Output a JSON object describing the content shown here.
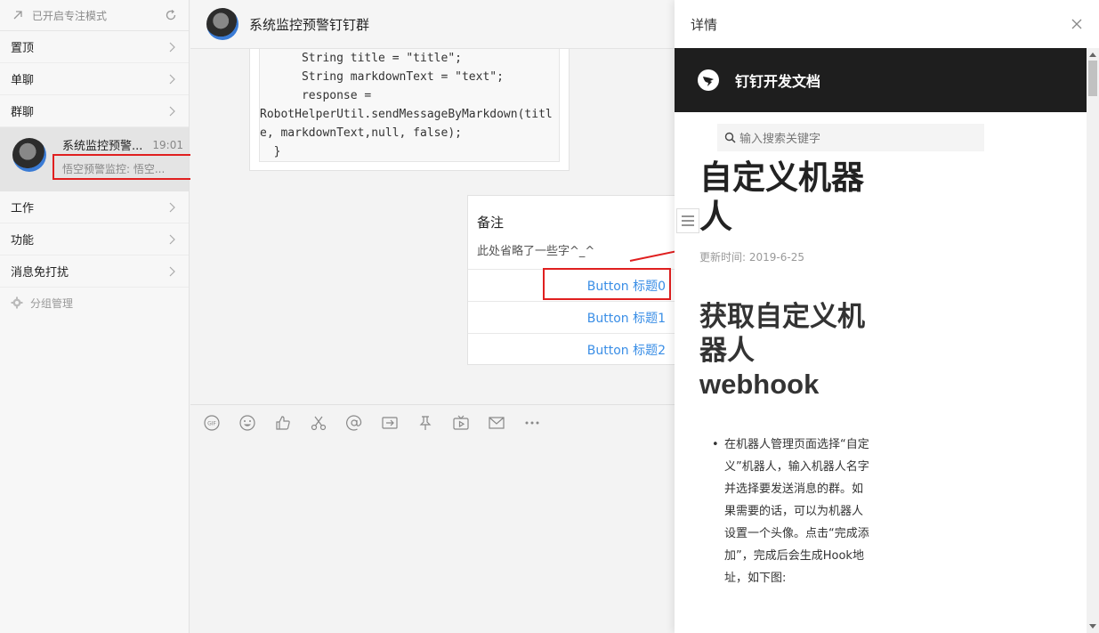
{
  "sidebar": {
    "focus_mode": "已开启专注模式",
    "groups": [
      {
        "label": "置顶"
      },
      {
        "label": "单聊"
      },
      {
        "label": "群聊"
      }
    ],
    "active_conversation": {
      "title": "系统监控预警...",
      "time": "19:01",
      "preview": "悟空预警监控: 悟空..."
    },
    "groups_after": [
      {
        "label": "工作"
      },
      {
        "label": "功能"
      },
      {
        "label": "消息免打扰"
      }
    ],
    "group_management": "分组管理"
  },
  "chat": {
    "title": "系统监控预警钉钉群",
    "code_lines": [
      "      String title = \"title\";",
      "      String markdownText = \"text\";",
      "      response =",
      "RobotHelperUtil.sendMessageByMarkdown(titl",
      "e, markdownText,null, false);",
      "  }"
    ],
    "action_card": {
      "title": "备注",
      "description": "此处省略了一些字^_^",
      "buttons": [
        "Button 标题0",
        "Button 标题1",
        "Button 标题2"
      ]
    },
    "toolbar_icons": [
      "gif-icon",
      "emoji-icon",
      "thumbs-up-icon",
      "scissors-icon",
      "at-icon",
      "share-icon",
      "pin-icon",
      "live-icon",
      "mail-icon",
      "more-icon"
    ]
  },
  "detail": {
    "header": "详情",
    "doc_brand": "钉钉开发文档",
    "search_placeholder": "输入搜索关键字",
    "h1": "自定义机器人",
    "updated": "更新时间: 2019-6-25",
    "h2": "获取自定义机器人webhook",
    "list_item": "在机器人管理页面选择“自定义”机器人，输入机器人名字并选择要发送消息的群。如果需要的话，可以为机器人设置一个头像。点击“完成添加”，完成后会生成Hook地址，如下图:"
  },
  "colors": {
    "accent": "#3a8ee6",
    "annotation_red": "#e01f1f",
    "doc_topbar": "#1e1e1e"
  }
}
